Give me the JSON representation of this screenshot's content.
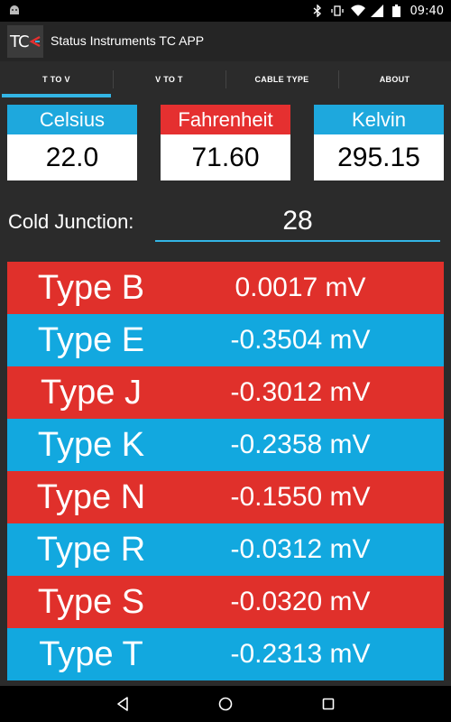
{
  "statusbar": {
    "time": "09:40"
  },
  "app": {
    "title": "Status Instruments TC APP",
    "logo_text": "TC"
  },
  "tabs": [
    {
      "label": "T TO V"
    },
    {
      "label": "V TO T"
    },
    {
      "label": "CABLE TYPE"
    },
    {
      "label": "ABOUT"
    }
  ],
  "temps": {
    "celsius": {
      "label": "Celsius",
      "value": "22.0",
      "color": "#1ea8dd"
    },
    "fahrenheit": {
      "label": "Fahrenheit",
      "value": "71.60",
      "color": "#e53030"
    },
    "kelvin": {
      "label": "Kelvin",
      "value": "295.15",
      "color": "#1ea8dd"
    }
  },
  "cold_junction": {
    "label": "Cold Junction:",
    "value": "28"
  },
  "types": [
    {
      "name": "Type B",
      "mv": "0.0017 mV",
      "color": "#e0302b"
    },
    {
      "name": "Type E",
      "mv": "-0.3504 mV",
      "color": "#12a8df"
    },
    {
      "name": "Type J",
      "mv": "-0.3012 mV",
      "color": "#e0302b"
    },
    {
      "name": "Type K",
      "mv": "-0.2358 mV",
      "color": "#12a8df"
    },
    {
      "name": "Type N",
      "mv": "-0.1550 mV",
      "color": "#e0302b"
    },
    {
      "name": "Type R",
      "mv": "-0.0312 mV",
      "color": "#12a8df"
    },
    {
      "name": "Type S",
      "mv": "-0.0320 mV",
      "color": "#e0302b"
    },
    {
      "name": "Type T",
      "mv": "-0.2313 mV",
      "color": "#12a8df"
    }
  ],
  "icons": {
    "status_left": "android-icon",
    "status_right": [
      "bluetooth-icon",
      "vibrate-icon",
      "wifi-icon",
      "signal-icon",
      "battery-icon"
    ],
    "nav": [
      "back-icon",
      "home-icon",
      "recents-icon"
    ]
  }
}
